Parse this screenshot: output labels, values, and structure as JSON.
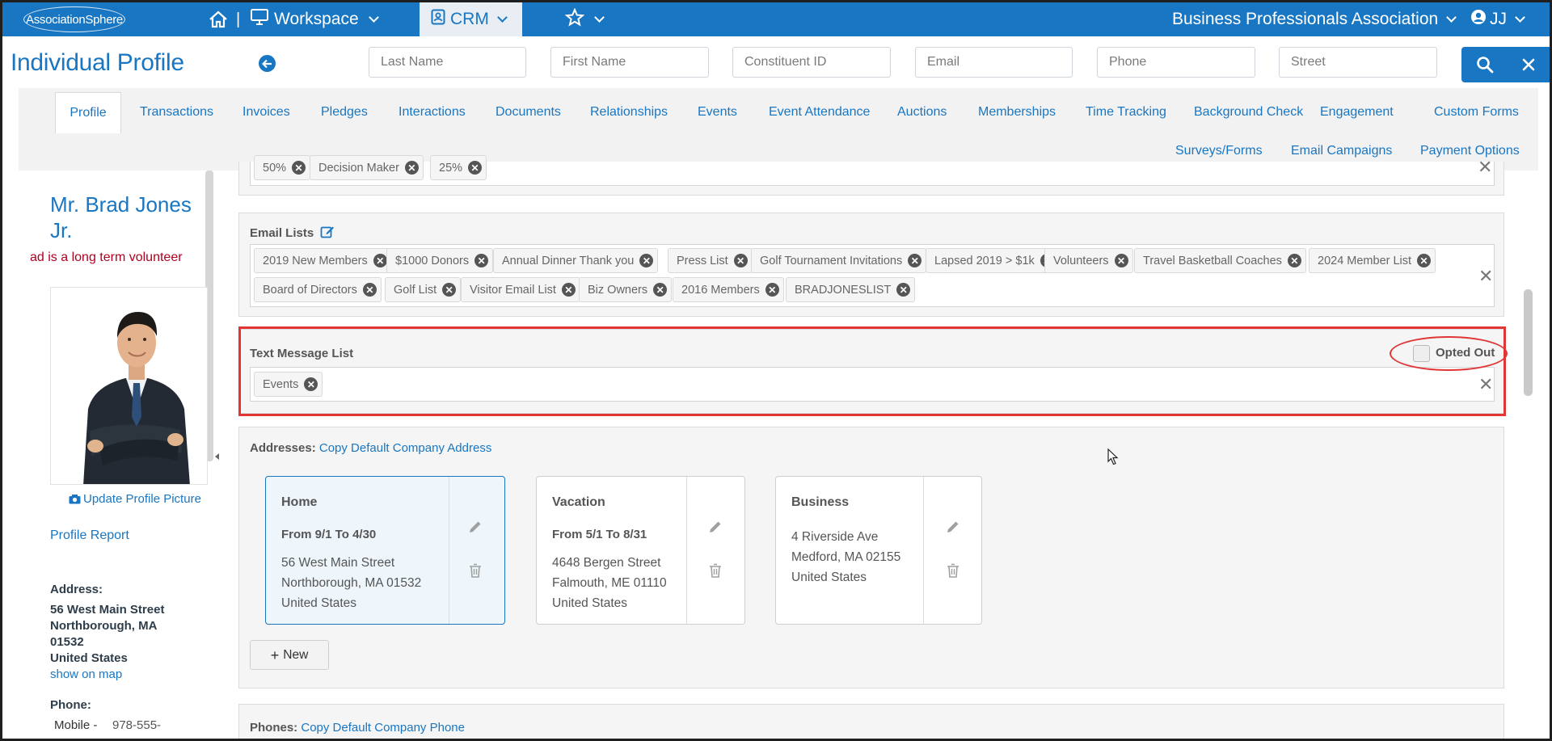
{
  "topbar": {
    "logo": "AssociationSphere",
    "workspace": "Workspace",
    "crm": "CRM",
    "org": "Business Professionals Association",
    "user": "JJ",
    "bg_color": "#1976c2"
  },
  "header": {
    "title": "Individual Profile",
    "search_placeholders": {
      "last_name": "Last Name",
      "first_name": "First Name",
      "constituent_id": "Constituent ID",
      "email": "Email",
      "phone": "Phone",
      "street": "Street"
    }
  },
  "tabs": {
    "profile": "Profile",
    "transactions": "Transactions",
    "invoices": "Invoices",
    "pledges": "Pledges",
    "interactions": "Interactions",
    "documents": "Documents",
    "relationships": "Relationships",
    "events": "Events",
    "event_attendance": "Event Attendance",
    "auctions": "Auctions",
    "memberships": "Memberships",
    "time_tracking": "Time Tracking",
    "background_check": "Background Check",
    "engagement": "Engagement",
    "custom_forms": "Custom Forms",
    "surveys_forms": "Surveys/Forms",
    "email_campaigns": "Email Campaigns",
    "payment_options": "Payment Options"
  },
  "profile": {
    "name_line1": "Mr. Brad Jones",
    "name_line2": "Jr.",
    "bio": "ad is a long term volunteer",
    "update_picture": "Update Profile Picture",
    "profile_report": "Profile Report",
    "address_label": "Address:",
    "address_line1": "56 West Main Street",
    "address_line2": "Northborough, MA",
    "address_line3": "01532",
    "address_line4": "United States",
    "show_on_map": "show on map",
    "phone_label": "Phone:",
    "phone_type": "Mobile -",
    "phone_value": "978-555-"
  },
  "top_tags": [
    "50%",
    "Decision Maker",
    "25%"
  ],
  "email_lists": {
    "label": "Email Lists",
    "row1": [
      "2019 New Members",
      "$1000 Donors",
      "Annual Dinner Thank you",
      "Press List",
      "Golf Tournament Invitations",
      "Lapsed 2019 > $1k",
      "Volunteers",
      "Travel Basketball Coaches",
      "2024 Member List"
    ],
    "row2": [
      "Board of Directors",
      "Golf List",
      "Visitor Email List",
      "Biz Owners",
      "2016 Members",
      "BRADJONESLIST"
    ]
  },
  "text_message": {
    "label": "Text Message List",
    "opted_out_label": "Opted Out",
    "tags": [
      "Events"
    ]
  },
  "addresses": {
    "label": "Addresses:",
    "copy_link": "Copy Default Company Address",
    "new_button": "New",
    "cards": [
      {
        "title": "Home",
        "from": "From 9/1 To 4/30",
        "line1": "56 West Main Street",
        "line2": "Northborough, MA 01532",
        "line3": "United States"
      },
      {
        "title": "Vacation",
        "from": "From 5/1 To 8/31",
        "line1": "4648 Bergen Street",
        "line2": "Falmouth, ME 01110",
        "line3": "United States"
      },
      {
        "title": "Business",
        "line1": "4 Riverside Ave",
        "line2": "Medford, MA 02155",
        "line3": "United States"
      }
    ]
  },
  "phones": {
    "label": "Phones:",
    "copy_link": "Copy Default Company Phone"
  }
}
